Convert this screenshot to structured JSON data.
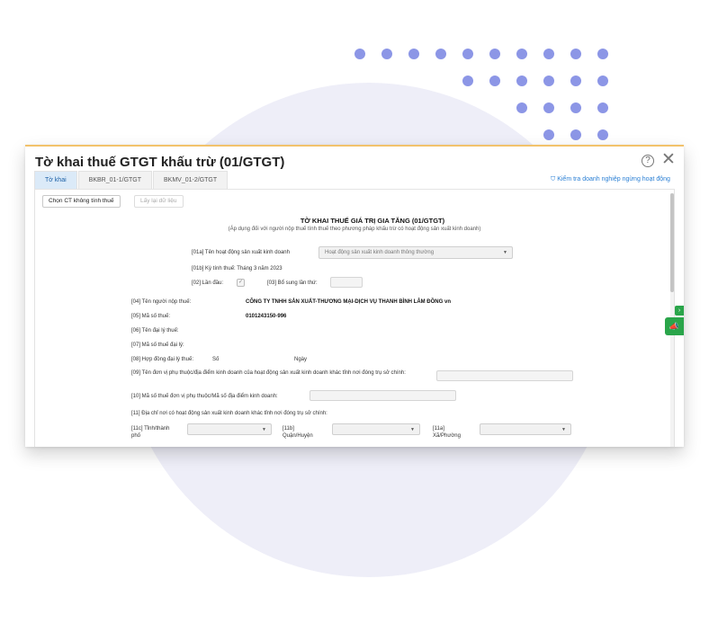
{
  "window": {
    "title": "Tờ khai thuế GTGT khấu trừ (01/GTGT)"
  },
  "tabs": [
    {
      "label": "Tờ khai"
    },
    {
      "label": "BKBR_01-1/GTGT"
    },
    {
      "label": "BKMV_01-2/GTGT"
    }
  ],
  "verify_link": "Kiểm tra doanh nghiệp ngừng hoạt động",
  "toolbar": {
    "choose_label": "Chọn CT không tính thuế",
    "reload_label": "Lấy lại dữ liệu"
  },
  "form": {
    "title": "TỜ KHAI THUẾ GIÁ TRỊ GIA TĂNG (01/GTGT)",
    "subtitle": "(Áp dụng đối với người nộp thuế tính thuế theo phương pháp khấu trừ có hoạt động sản xuất kinh doanh)",
    "f01a_label": "[01a] Tên hoạt động sản xuất kinh doanh",
    "f01a_value": "Hoạt động sản xuất kinh doanh thông thường",
    "f01b_label": "[01b] Kỳ tính thuế: Tháng 3 năm 2023",
    "f02_label": "[02] Lần đầu:",
    "f03_label": "[03] Bổ sung lần thứ:",
    "f04_label": "[04] Tên người nộp thuế:",
    "f04_value": "CÔNG TY TNHH SẢN XUẤT-THƯƠNG MẠI-DỊCH VỤ THANH BÌNH LÂM ĐỒNG vn",
    "f05_label": "[05] Mã số thuế:",
    "f05_value": "0101243150-996",
    "f06_label": "[06] Tên đại lý thuế:",
    "f07_label": "[07] Mã số thuế đại lý:",
    "f08_label": "[08] Hợp đồng đại lý thuế:",
    "f08_so": "Số",
    "f08_ngay": "Ngày",
    "f09_label": "[09] Tên đơn vị phụ thuộc/địa điểm kinh doanh của hoạt động sản xuất kinh doanh khác tỉnh nơi đóng trụ sở chính:",
    "f10_label": "[10] Mã số thuế đơn vị phụ thuộc/Mã số địa điểm kinh doanh:",
    "f11_label": "[11] Địa chỉ nơi có hoạt động sản xuất kinh doanh khác tỉnh nơi đóng trụ sở chính:",
    "f11c_label": "[11c] Tỉnh/thành phố",
    "f11b_label": "[11b] Quận/Huyện",
    "f11a_label": "[11a] Xã/Phường"
  },
  "accent_colors": {
    "brand_green": "#2aa54a",
    "link_blue": "#2a7fd4",
    "dots": "#8c96e6"
  }
}
